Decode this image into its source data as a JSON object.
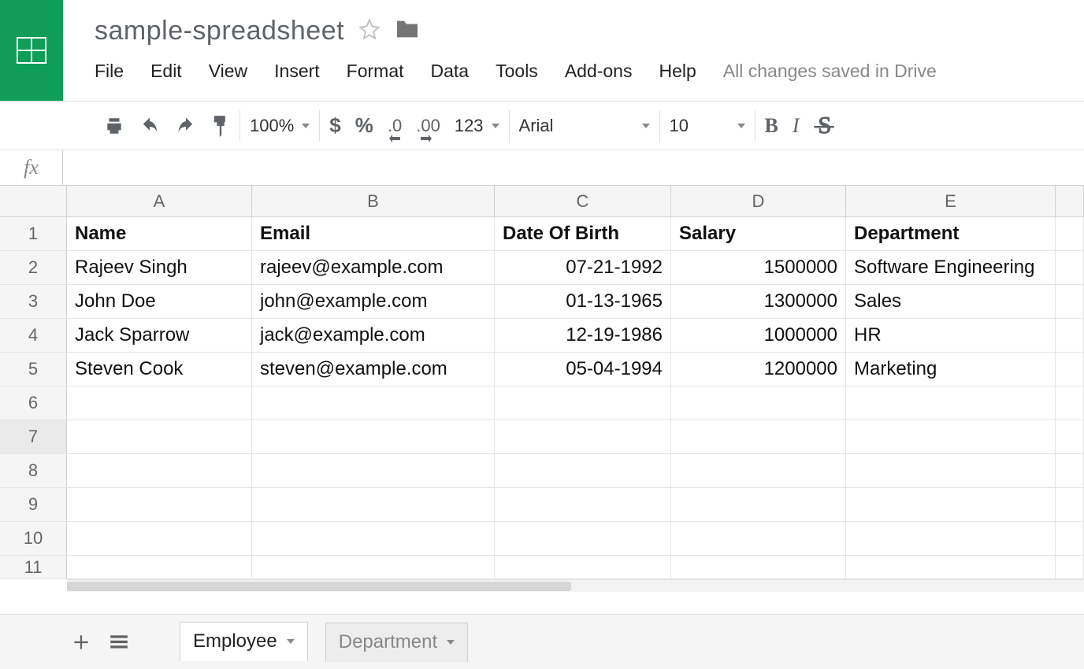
{
  "doc_title": "sample-spreadsheet",
  "menu": {
    "file": "File",
    "edit": "Edit",
    "view": "View",
    "insert": "Insert",
    "format": "Format",
    "data": "Data",
    "tools": "Tools",
    "addons": "Add-ons",
    "help": "Help"
  },
  "save_status": "All changes saved in Drive",
  "toolbar": {
    "zoom": "100%",
    "currency": "$",
    "percent": "%",
    "dec_dec": ".0",
    "inc_dec": ".00",
    "num_format": "123",
    "font": "Arial",
    "font_size": "10",
    "bold": "B",
    "italic": "I",
    "strike": "S"
  },
  "fx_label": "fx",
  "columns": {
    "A": "A",
    "B": "B",
    "C": "C",
    "D": "D",
    "E": "E"
  },
  "row_numbers": {
    "r1": "1",
    "r2": "2",
    "r3": "3",
    "r4": "4",
    "r5": "5",
    "r6": "6",
    "r7": "7",
    "r8": "8",
    "r9": "9",
    "r10": "10",
    "r11": "11"
  },
  "sheet_headers": {
    "name": "Name",
    "email": "Email",
    "dob": "Date Of Birth",
    "salary": "Salary",
    "dept": "Department"
  },
  "rows": {
    "r2": {
      "name": "Rajeev Singh",
      "email": "rajeev@example.com",
      "dob": "07-21-1992",
      "salary": "1500000",
      "dept": "Software Engineering"
    },
    "r3": {
      "name": "John Doe",
      "email": "john@example.com",
      "dob": "01-13-1965",
      "salary": "1300000",
      "dept": "Sales"
    },
    "r4": {
      "name": "Jack Sparrow",
      "email": "jack@example.com",
      "dob": "12-19-1986",
      "salary": "1000000",
      "dept": "HR"
    },
    "r5": {
      "name": "Steven Cook",
      "email": "steven@example.com",
      "dob": "05-04-1994",
      "salary": "1200000",
      "dept": "Marketing"
    }
  },
  "tabs": {
    "employee": "Employee",
    "department": "Department"
  }
}
